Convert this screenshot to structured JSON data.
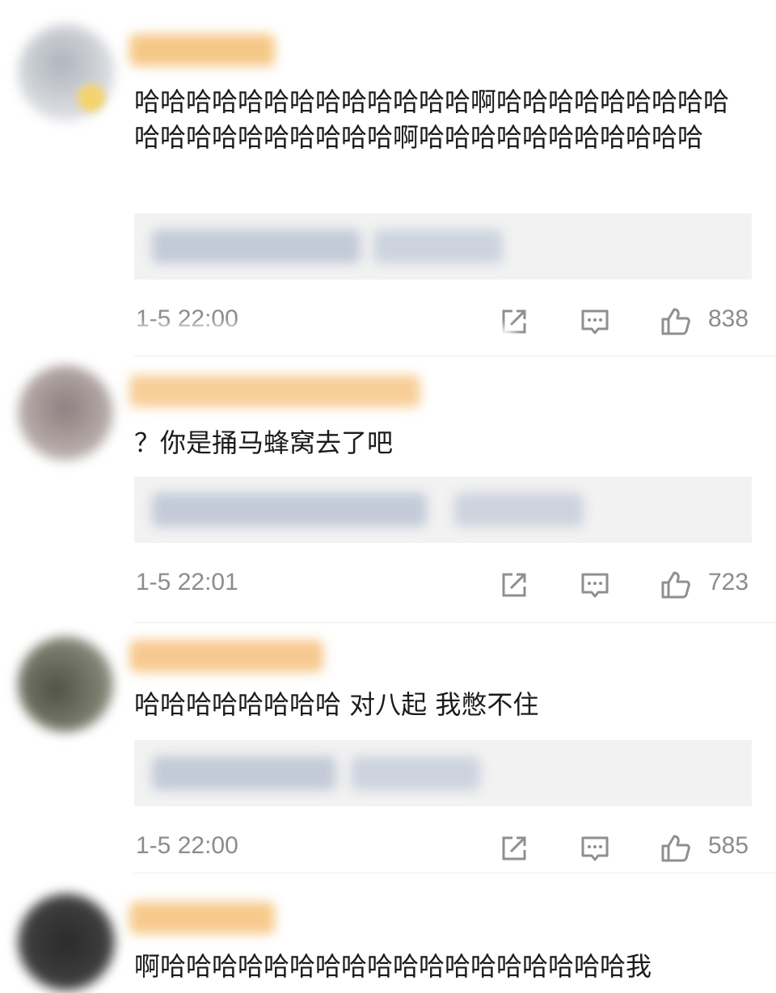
{
  "comments": [
    {
      "text": "哈哈哈哈哈哈哈哈哈哈哈哈哈啊哈哈哈哈哈哈哈哈哈哈哈哈哈哈哈哈哈哈哈啊哈哈哈哈哈哈哈哈哈哈哈",
      "time": "1-5 22:00",
      "likes": "838"
    },
    {
      "text": "？你是捅马蜂窝去了吧",
      "time": "1-5 22:01",
      "likes": "723"
    },
    {
      "text": "哈哈哈哈哈哈哈哈 对八起 我憋不住",
      "time": "1-5 22:00",
      "likes": "585"
    },
    {
      "text": "啊哈哈哈哈哈哈哈哈哈哈哈哈哈哈哈哈哈哈我"
    }
  ],
  "icons": {
    "share": "share-icon",
    "comment": "comment-icon",
    "like": "thumbs-up-icon"
  },
  "colors": {
    "text": "#1b1b1b",
    "meta": "#8c8c8c",
    "reply_bg": "#f2f2f2",
    "username_blur": "#f7c989"
  }
}
